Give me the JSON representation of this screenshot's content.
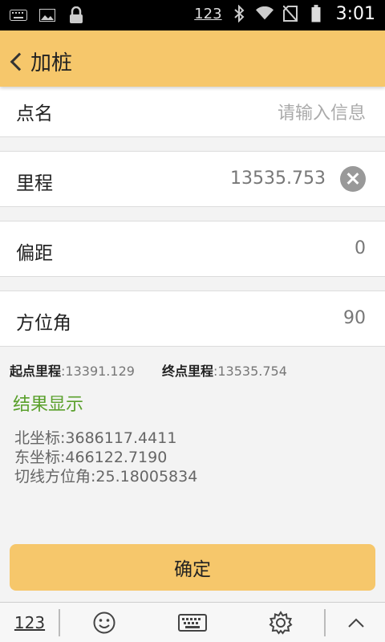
{
  "statusbar": {
    "input_mode": "123",
    "time": "3:01",
    "icons": [
      "keyboard-icon",
      "image-icon",
      "lock-icon",
      "bluetooth-icon",
      "wifi-icon",
      "no-sim-icon",
      "battery-icon"
    ]
  },
  "appbar": {
    "title": "加桩",
    "back_icon": "chevron-left-icon"
  },
  "fields": [
    {
      "label": "点名",
      "value": "",
      "placeholder": "请输入信息"
    },
    {
      "label": "里程",
      "value": "13535.753",
      "placeholder": ""
    },
    {
      "label": "偏距",
      "value": "0",
      "placeholder": ""
    },
    {
      "label": "方位角",
      "value": "90",
      "placeholder": ""
    }
  ],
  "range": {
    "start_label": "起点里程",
    "start_value": ":13391.129",
    "end_label": "终点里程",
    "end_value": ":13535.754"
  },
  "result": {
    "title": "结果显示",
    "lines": [
      "北坐标:3686117.4411",
      "东坐标:466122.7190",
      "切线方位角:25.18005834"
    ]
  },
  "confirm_label": "确定",
  "keyboard_bar": {
    "mode_label": "123"
  },
  "colors": {
    "accent": "#f6c76b",
    "result_green": "#5aa02c"
  }
}
